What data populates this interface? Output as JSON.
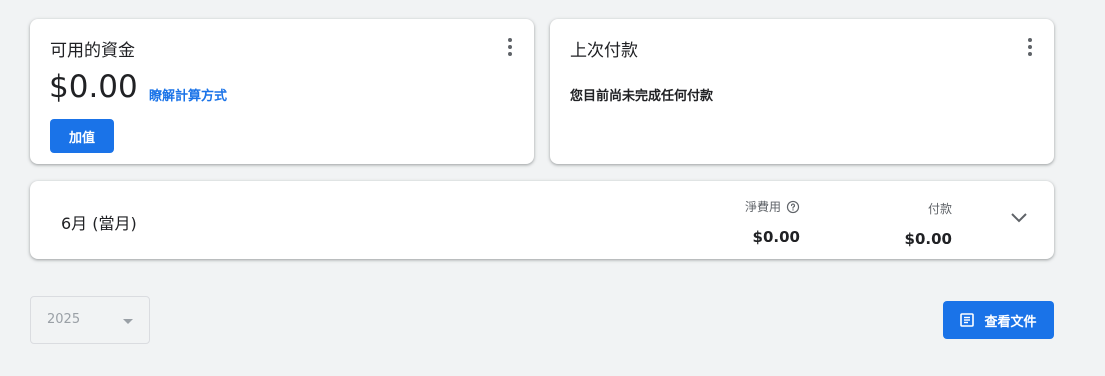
{
  "funds_card": {
    "title": "可用的資金",
    "balance": "$0.00",
    "learn_link": "瞭解計算方式",
    "add_button": "加值"
  },
  "last_payment_card": {
    "title": "上次付款",
    "message": "您目前尚未完成任何付款"
  },
  "month_card": {
    "label": "6月 (當月)",
    "net_cost_label": "淨費用",
    "net_cost_value": "$0.00",
    "payment_label": "付款",
    "payment_value": "$0.00"
  },
  "year_select": {
    "value": "2025"
  },
  "view_docs_button": "查看文件",
  "colors": {
    "accent": "#1a73e8",
    "background": "#f1f3f4"
  },
  "icons": [
    "more-vert-icon",
    "help-icon",
    "chevron-down-icon",
    "dropdown-arrow-icon",
    "document-icon"
  ]
}
